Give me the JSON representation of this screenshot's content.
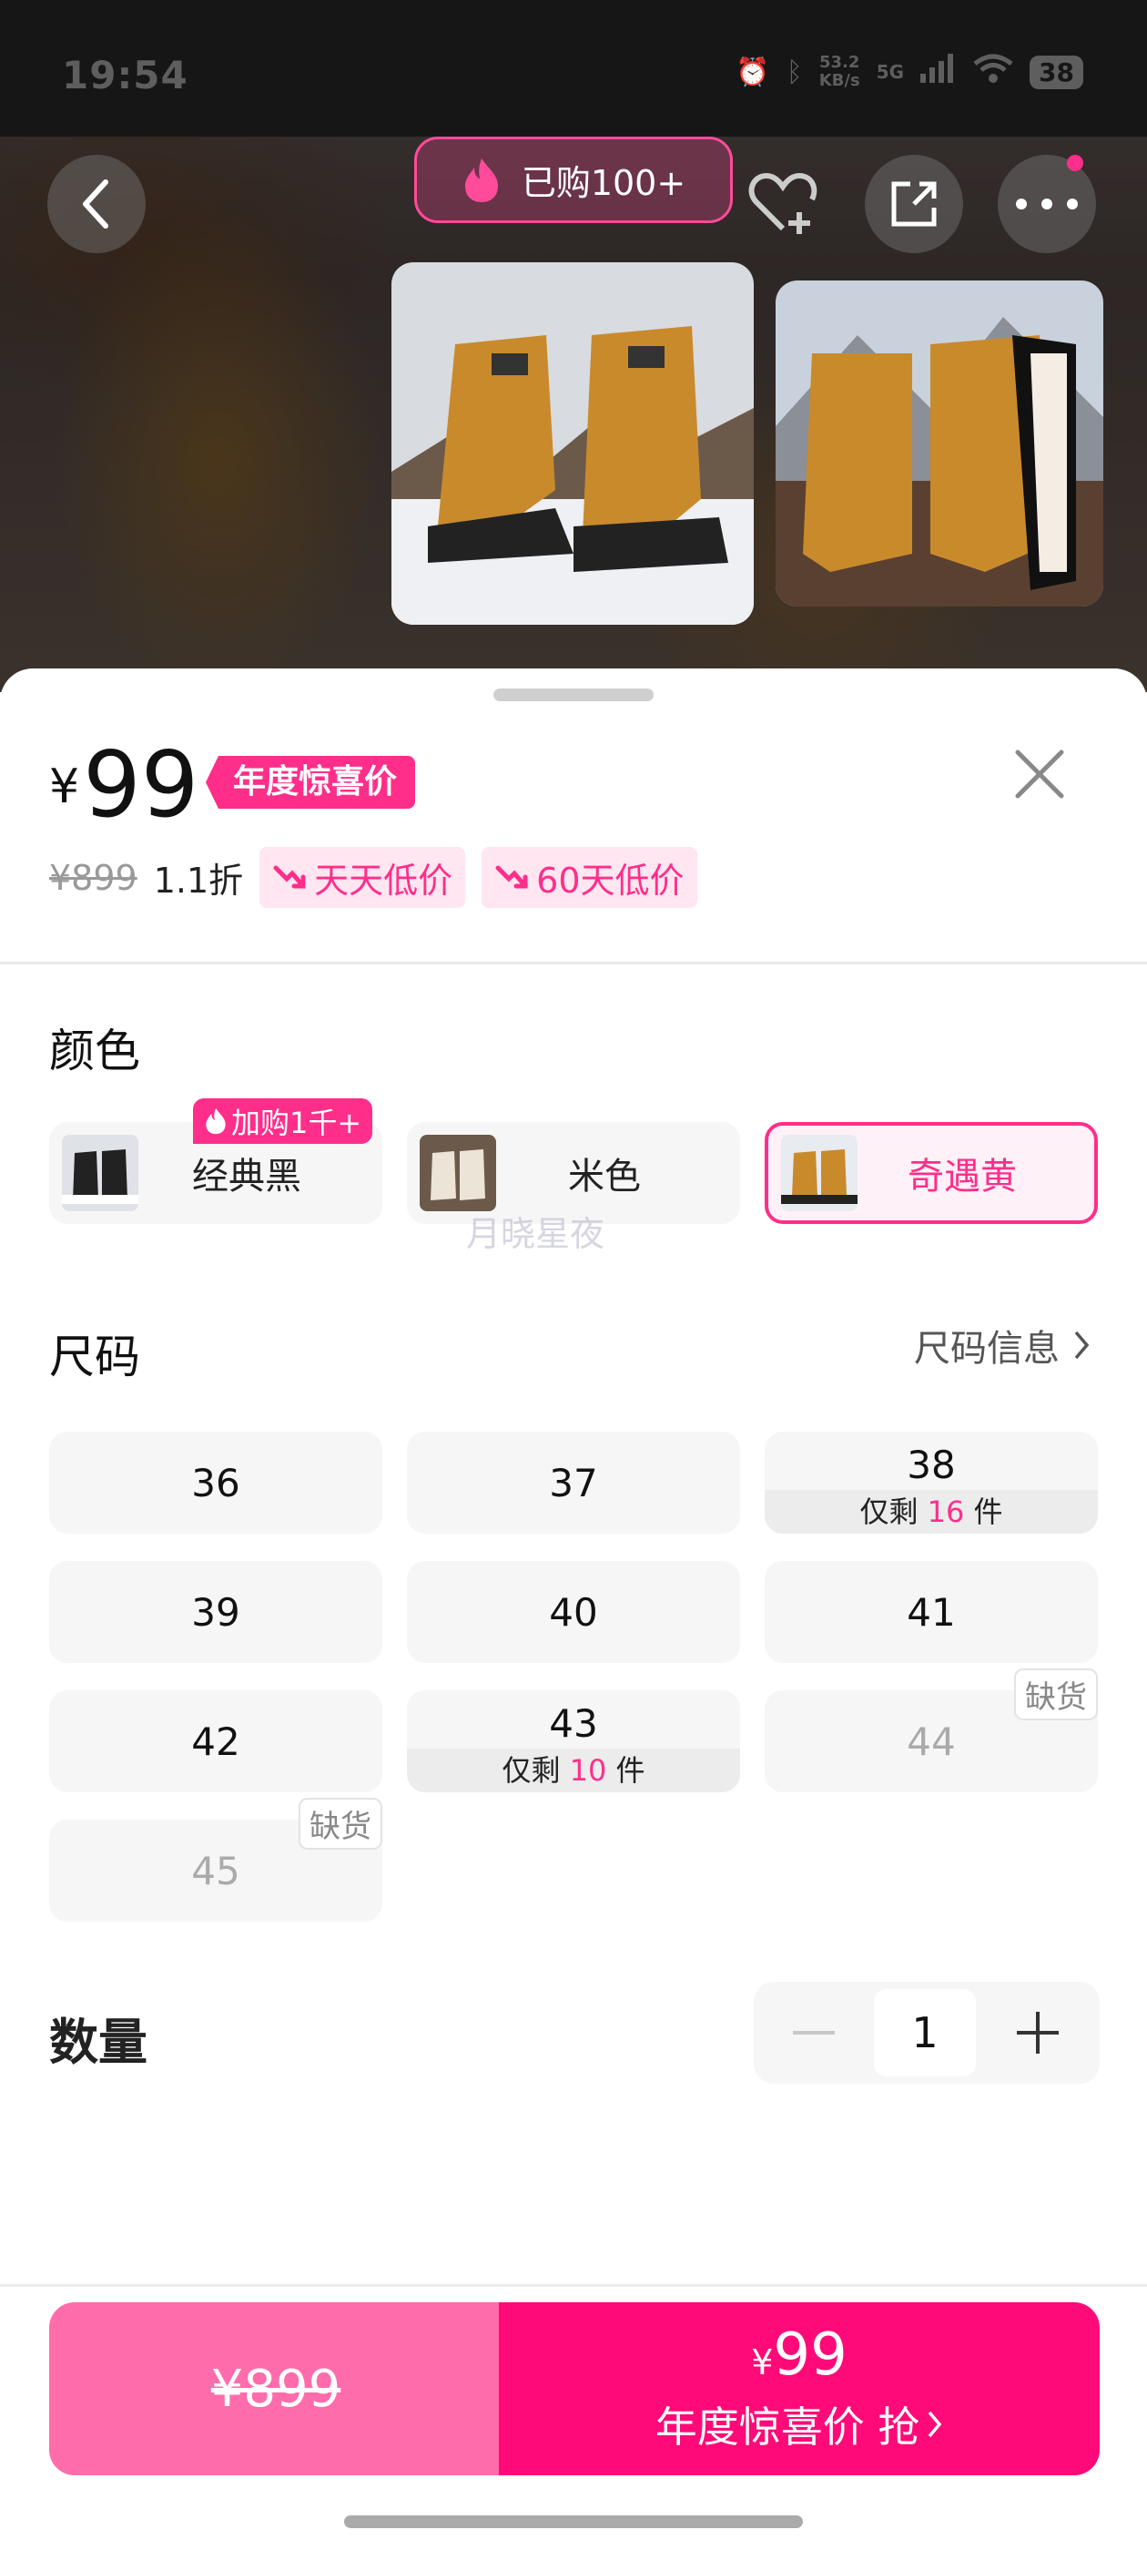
{
  "status_bar": {
    "time": "19:54",
    "speed_value": "53.2",
    "speed_unit": "KB/s",
    "network": "5G",
    "battery": "38"
  },
  "header": {
    "sold_label": "已购100+"
  },
  "price": {
    "currency": "¥",
    "value": "99",
    "promo_tag": "年度惊喜价",
    "original": "¥899",
    "discount": "1.1折",
    "chips": [
      "天天低价",
      "60天低价"
    ]
  },
  "color": {
    "title": "颜色",
    "options": [
      {
        "label": "经典黑",
        "badge": "加购1千+",
        "selected": false
      },
      {
        "label": "米色",
        "selected": false
      },
      {
        "label": "奇遇黄",
        "selected": true
      }
    ],
    "watermark": "月晓星夜"
  },
  "size": {
    "title": "尺码",
    "info_link": "尺码信息",
    "options": [
      {
        "label": "36"
      },
      {
        "label": "37"
      },
      {
        "label": "38",
        "stock_prefix": "仅剩",
        "stock_count": "16",
        "stock_suffix": "件"
      },
      {
        "label": "39"
      },
      {
        "label": "40"
      },
      {
        "label": "41"
      },
      {
        "label": "42"
      },
      {
        "label": "43",
        "stock_prefix": "仅剩",
        "stock_count": "10",
        "stock_suffix": "件"
      },
      {
        "label": "44",
        "badge": "缺货"
      },
      {
        "label": "45",
        "badge": "缺货"
      }
    ]
  },
  "quantity": {
    "title": "数量",
    "value": "1"
  },
  "footer": {
    "original_price": "¥899",
    "buy_currency": "¥",
    "buy_price": "99",
    "buy_label": "年度惊喜价 抢"
  },
  "colors": {
    "accent": "#ff2e8a",
    "buy_left": "#ff6cab",
    "buy_right": "#ff0a78"
  }
}
